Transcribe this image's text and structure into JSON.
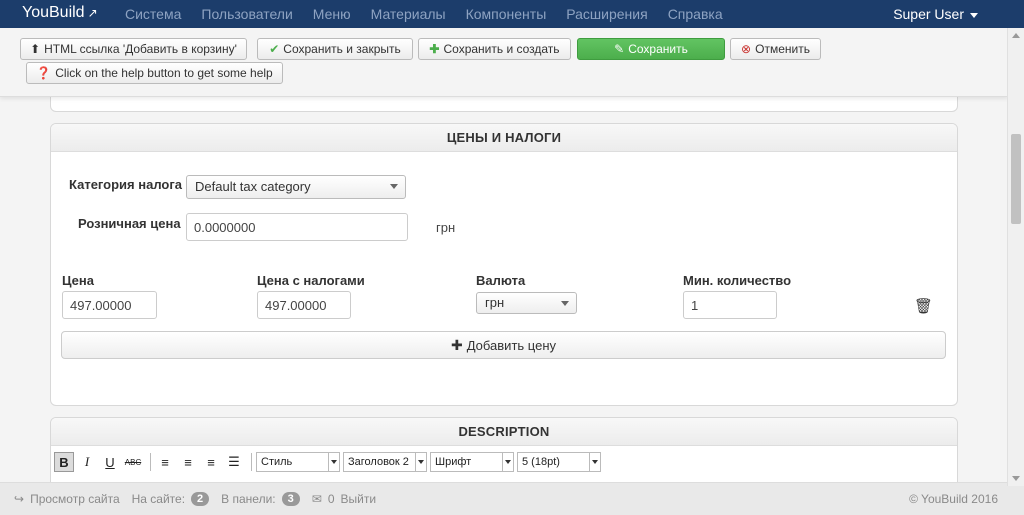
{
  "navbar": {
    "brand": "YouBuild",
    "menu": [
      "Система",
      "Пользователи",
      "Меню",
      "Материалы",
      "Компоненты",
      "Расширения",
      "Справка"
    ],
    "user": "Super User"
  },
  "toolbar": {
    "html_link": "HTML ссылка 'Добавить в корзину'",
    "save_close": "Сохранить и закрыть",
    "save_new": "Сохранить и создать",
    "save": "Сохранить",
    "cancel": "Отменить",
    "help": "Click on the help button to get some help"
  },
  "prices_panel": {
    "title": "ЦЕНЫ И НАЛОГИ",
    "tax_label": "Категория налога",
    "tax_value": "Default tax category",
    "retail_label": "Розничная цена",
    "retail_value": "0.0000000",
    "retail_unit": "грн",
    "price_label": "Цена",
    "price_value": "497.00000",
    "price_tax_label": "Цена с налогами",
    "price_tax_value": "497.00000",
    "currency_label": "Валюта",
    "currency_value": "грн",
    "min_qty_label": "Мин. количество",
    "min_qty_value": "1",
    "add_price": "Добавить цену"
  },
  "description_panel": {
    "title": "DESCRIPTION",
    "style_select": "Стиль",
    "heading_select": "Заголовок 2",
    "font_select": "Шрифт",
    "size_select": "5 (18pt)"
  },
  "footer": {
    "view_site": "Просмотр сайта",
    "on_site_label": "На сайте:",
    "on_site_count": "2",
    "in_panel_label": "В панели:",
    "in_panel_count": "3",
    "messages_count": "0",
    "logout": "Выйти",
    "copyright": "© YouBuild 2016"
  }
}
